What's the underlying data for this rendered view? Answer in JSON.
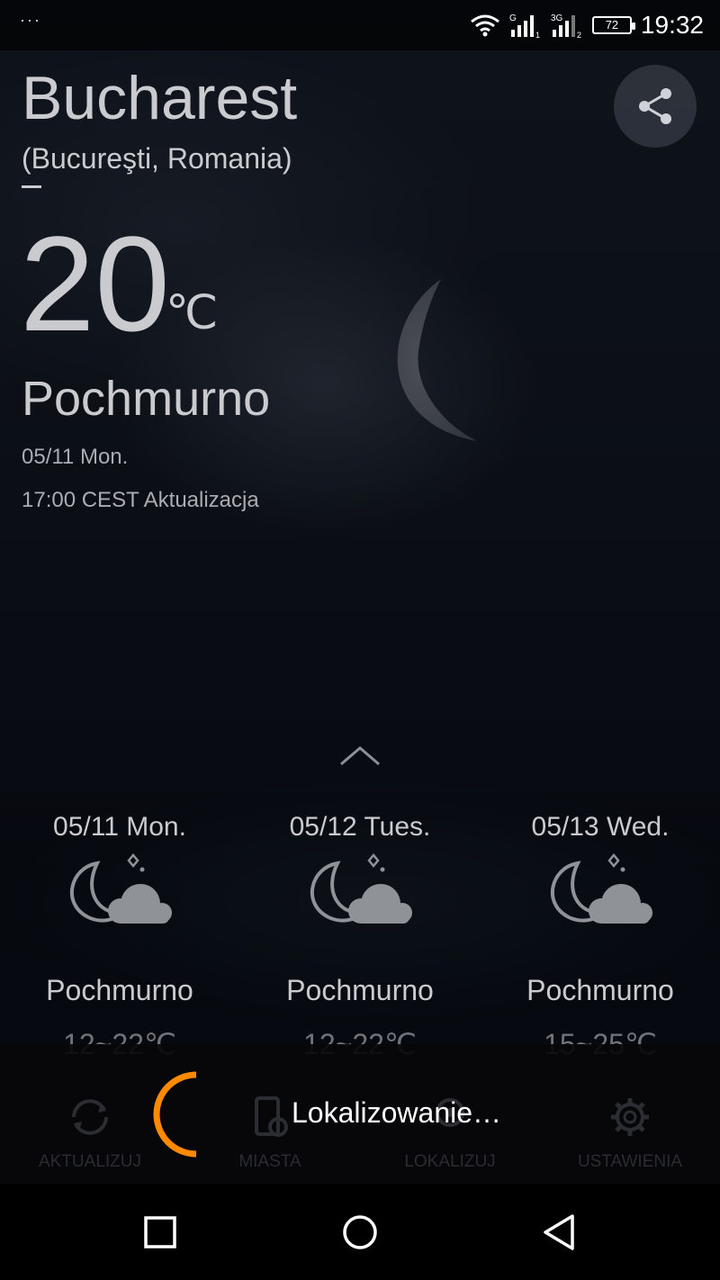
{
  "status_bar": {
    "notification_dots": "···",
    "battery": "72",
    "time": "19:32",
    "icons": [
      "wifi-icon",
      "signal-g-icon",
      "signal-3g-icon",
      "battery-icon"
    ]
  },
  "header": {
    "city": "Bucharest",
    "subtitle": "(Bucureşti, Romania)",
    "share_icon": "share-icon"
  },
  "current": {
    "temperature": "20",
    "unit": "℃",
    "condition": "Pochmurno",
    "date": "05/11 Mon.",
    "updated": "17:00 CEST Aktualizacja"
  },
  "forecast": [
    {
      "date": "05/11 Mon.",
      "condition": "Pochmurno",
      "range": "12~22℃",
      "icon": "moon-cloud-icon"
    },
    {
      "date": "05/12 Tues.",
      "condition": "Pochmurno",
      "range": "12~22℃",
      "icon": "moon-cloud-icon"
    },
    {
      "date": "05/13 Wed.",
      "condition": "Pochmurno",
      "range": "15~25℃",
      "icon": "moon-cloud-icon"
    }
  ],
  "bottom_nav": [
    {
      "label": "AKTUALIZUJ",
      "icon": "refresh-icon"
    },
    {
      "label": "MIASTA",
      "icon": "cities-icon"
    },
    {
      "label": "LOKALIZUJ",
      "icon": "location-icon"
    },
    {
      "label": "USTAWIENIA",
      "icon": "gear-icon"
    }
  ],
  "toast": {
    "text": "Lokalizowanie…",
    "spinner_color": "#ff8a00"
  },
  "system_nav": [
    "recents-icon",
    "home-icon",
    "back-icon"
  ]
}
